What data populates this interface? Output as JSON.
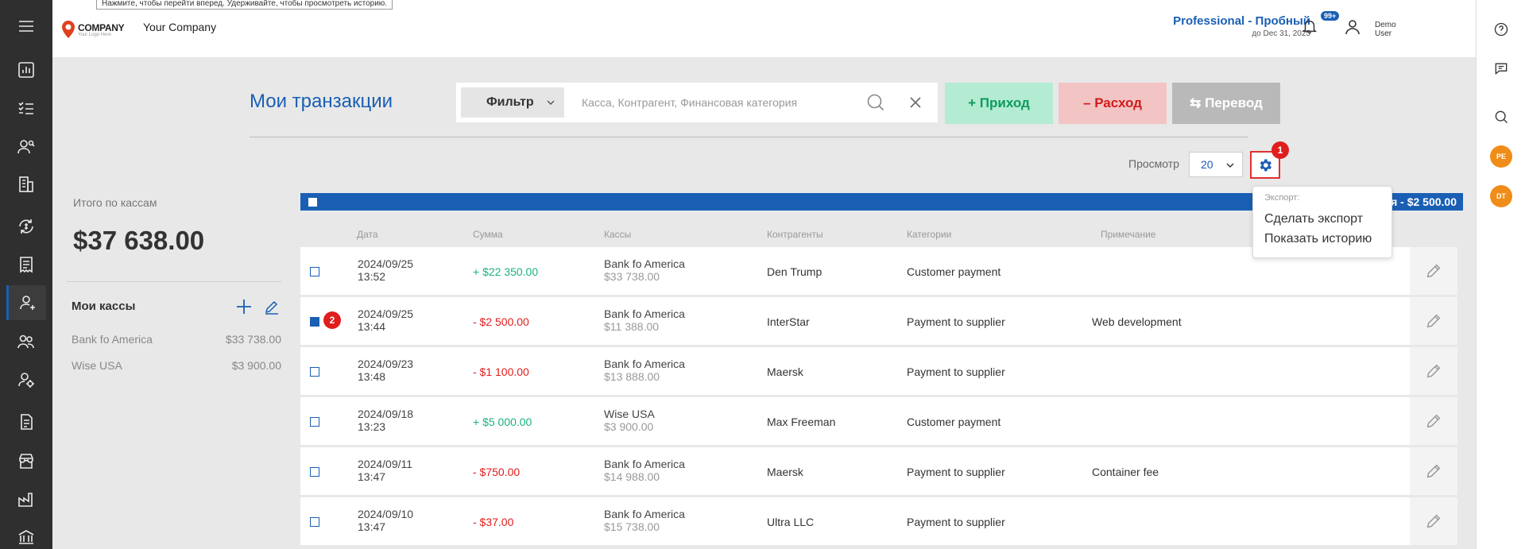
{
  "tooltip": "Нажмите, чтобы перейти вперед. Удерживайте, чтобы просмотреть историю.",
  "logo": {
    "name": "COMPANY",
    "tagline": "Your Logo Here"
  },
  "company_name": "Your Company",
  "plan": {
    "name": "Professional - Пробный",
    "until": "до Dec 31, 2025"
  },
  "notifications": {
    "badge": "99+"
  },
  "user": {
    "line1": "Demo",
    "line2": "User"
  },
  "nav_icons": [
    "menu-icon",
    "dashboard-icon",
    "checklist-icon",
    "people-search-icon",
    "building-icon",
    "cash-cycle-icon",
    "receipt-icon",
    "user-cash-icon",
    "group-icon",
    "user-settings-icon",
    "document-icon",
    "store-icon",
    "factory-icon",
    "bank-icon"
  ],
  "right_rail": {
    "avatars": [
      "PE",
      "DT"
    ]
  },
  "page": {
    "title": "Мои транзакции"
  },
  "search": {
    "filter_label": "Фильтр",
    "placeholder": "Касса, Контрагент, Финансовая категория"
  },
  "actions": {
    "income": "+ Приход",
    "expense": "– Расход",
    "transfer": "⇆ Перевод"
  },
  "view": {
    "label": "Просмотр",
    "value": "20"
  },
  "markers": {
    "gear": "1",
    "row": "2"
  },
  "totals": {
    "label": "Итого по кассам",
    "value": "$37 638.00"
  },
  "kassy": {
    "title": "Мои кассы",
    "items": [
      {
        "name": "Bank fo America",
        "amount": "$33 738.00"
      },
      {
        "name": "Wise USA",
        "amount": "$3 900.00"
      }
    ]
  },
  "selection_bar": {
    "text": "я - $2 500.00"
  },
  "columns": {
    "date": "Дата",
    "sum": "Сумма",
    "kassa": "Кассы",
    "contractor": "Контрагенты",
    "category": "Категории",
    "note": "Примечание"
  },
  "rows": [
    {
      "date": "2024/09/25",
      "time": "13:52",
      "sum": "+ $22 350.00",
      "sign": "plus",
      "kassa": "Bank fo America",
      "balance": "$33 738.00",
      "contractor": "Den Trump",
      "category": "Customer payment",
      "note": "",
      "checked": false
    },
    {
      "date": "2024/09/25",
      "time": "13:44",
      "sum": "- $2 500.00",
      "sign": "minus",
      "kassa": "Bank fo America",
      "balance": "$11 388.00",
      "contractor": "InterStar",
      "category": "Payment to supplier",
      "note": "Web development",
      "checked": true
    },
    {
      "date": "2024/09/23",
      "time": "13:48",
      "sum": "- $1 100.00",
      "sign": "minus",
      "kassa": "Bank fo America",
      "balance": "$13 888.00",
      "contractor": "Maersk",
      "category": "Payment to supplier",
      "note": "",
      "checked": false
    },
    {
      "date": "2024/09/18",
      "time": "13:23",
      "sum": "+ $5 000.00",
      "sign": "plus",
      "kassa": "Wise USA",
      "balance": "$3 900.00",
      "contractor": "Max Freeman",
      "category": "Customer payment",
      "note": "",
      "checked": false
    },
    {
      "date": "2024/09/11",
      "time": "13:47",
      "sum": "- $750.00",
      "sign": "minus",
      "kassa": "Bank fo America",
      "balance": "$14 988.00",
      "contractor": "Maersk",
      "category": "Payment to supplier",
      "note": "Container fee",
      "checked": false
    },
    {
      "date": "2024/09/10",
      "time": "13:47",
      "sum": "- $37.00",
      "sign": "minus",
      "kassa": "Bank fo America",
      "balance": "$15 738.00",
      "contractor": "Ultra LLC",
      "category": "Payment to supplier",
      "note": "",
      "checked": false
    }
  ],
  "export_menu": {
    "label": "Экспорт:",
    "items": [
      "Сделать экспорт",
      "Показать историю"
    ]
  },
  "colors": {
    "accent": "#1a5fb4",
    "income": "#19b37a",
    "expense": "#e01e1e",
    "marker": "#e01e1e"
  }
}
